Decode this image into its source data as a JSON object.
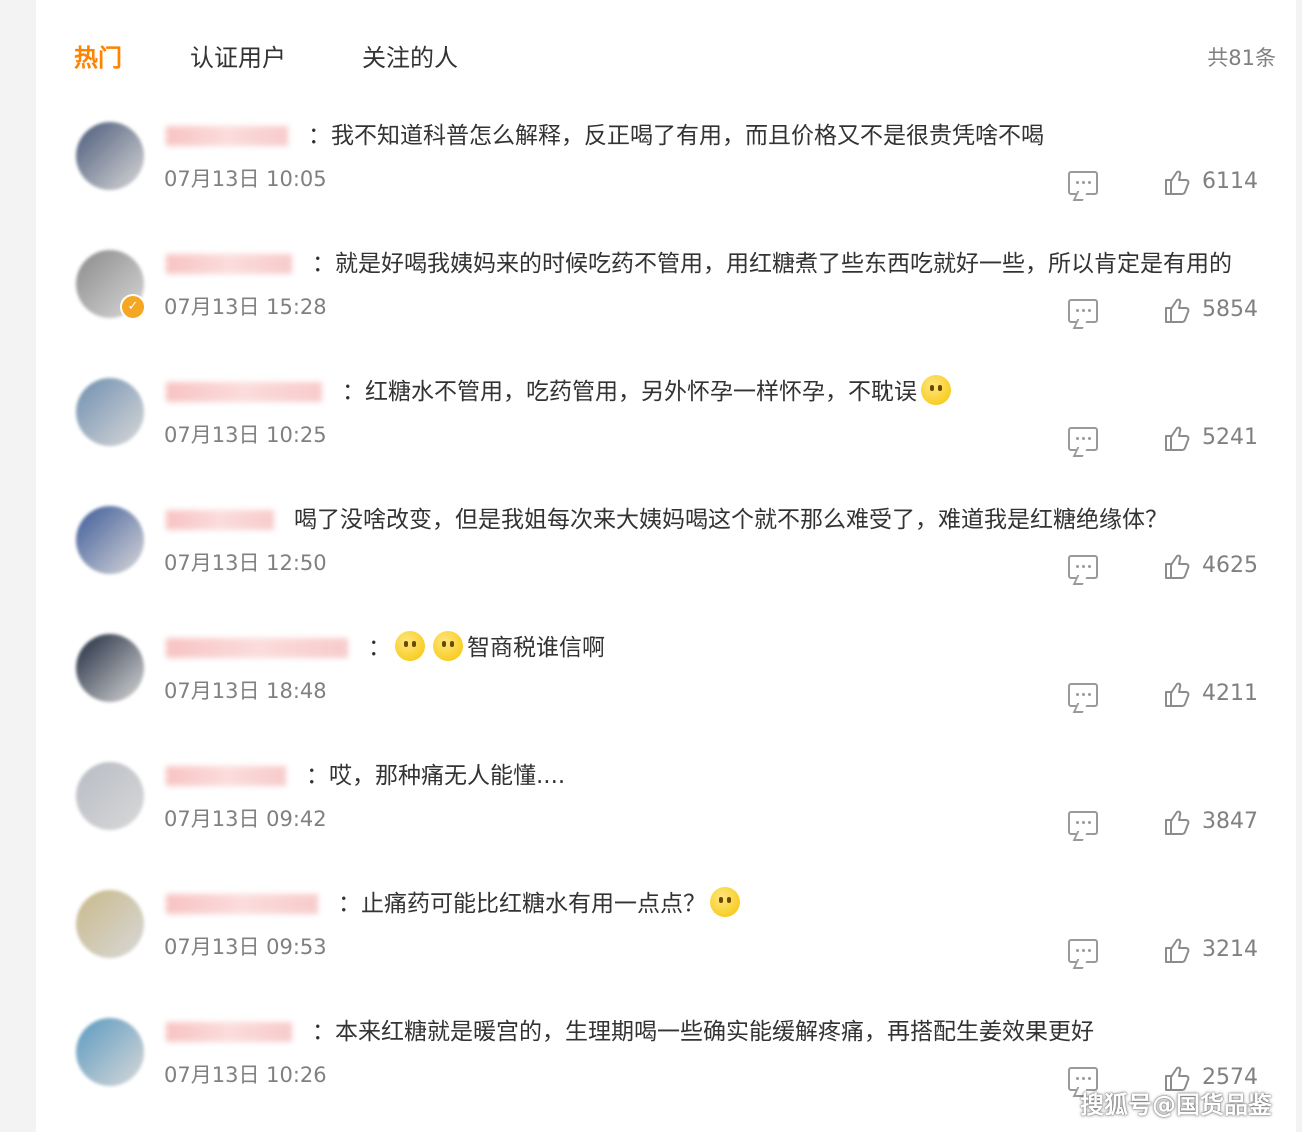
{
  "tabs": [
    "热门",
    "认证用户",
    "关注的人"
  ],
  "total": "共81条",
  "comments": [
    {
      "text": "：我不知道科普怎么解释，反正喝了有用，而且价格又不是很贵凭啥不喝",
      "time": "07月13日 10:05",
      "likes": "6114",
      "avatar_color": "#4a5a7a"
    },
    {
      "text": "：就是好喝我姨妈来的时候吃药不管用，用红糖煮了些东西吃就好一些，所以肯定是有用的",
      "time": "07月13日 15:28",
      "likes": "5854",
      "avatar_color": "#8a8a8a",
      "verified": true
    },
    {
      "text": "：红糖水不管用，吃药管用，另外怀孕一样怀孕，不耽误",
      "time": "07月13日 10:25",
      "likes": "5241",
      "avatar_color": "#6f8fb0",
      "emoji_after": 1
    },
    {
      "text": "喝了没啥改变，但是我姐每次来大姨妈喝这个就不那么难受了，难道我是红糖绝缘体？",
      "time": "07月13日 12:50",
      "likes": "4625",
      "avatar_color": "#3d5a9a"
    },
    {
      "text": "智商税谁信啊",
      "prefix": "：",
      "time": "07月13日 18:48",
      "likes": "4211",
      "avatar_color": "#1f2a3e",
      "emoji_before": 2
    },
    {
      "text": "：哎，那种痛无人能懂....",
      "time": "07月13日 09:42",
      "likes": "3847",
      "avatar_color": "#b8bcc4"
    },
    {
      "text": "：止痛药可能比红糖水有用一点点？",
      "time": "07月13日 09:53",
      "likes": "3214",
      "avatar_color": "#c9b98a",
      "emoji_after": 1
    },
    {
      "text": "：本来红糖就是暖宫的，生理期喝一些确实能缓解疼痛，再搭配生姜效果更好",
      "time": "07月13日 10:26",
      "likes": "2574",
      "avatar_color": "#5a9ac0"
    }
  ],
  "watermark": "搜狐号@国货品鉴"
}
